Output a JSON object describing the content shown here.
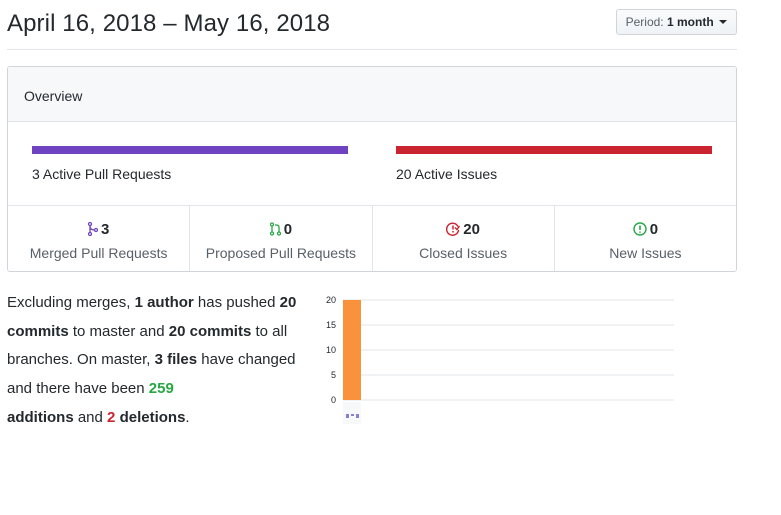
{
  "header": {
    "date_range": "April 16, 2018 – May 16, 2018",
    "period_prefix": "Period:",
    "period_value": "1 month"
  },
  "overview": {
    "title": "Overview",
    "pr_bar_color": "#6f42c1",
    "issue_bar_color": "#cb2431",
    "active_prs_label": "3 Active Pull Requests",
    "active_issues_label": "20 Active Issues",
    "stats": [
      {
        "icon": "git-merge-icon",
        "count": "3",
        "label": "Merged Pull Requests",
        "color": "#6f42c1"
      },
      {
        "icon": "git-pull-request-icon",
        "count": "0",
        "label": "Proposed Pull Requests",
        "color": "#28a745"
      },
      {
        "icon": "issue-closed-icon",
        "count": "20",
        "label": "Closed Issues",
        "color": "#cb2431"
      },
      {
        "icon": "issue-opened-icon",
        "count": "0",
        "label": "New Issues",
        "color": "#28a745"
      }
    ]
  },
  "summary": {
    "p1": "Excluding merges, ",
    "authors": "1 author",
    "p2": " has pushed ",
    "commits_master": "20 commits",
    "p3": " to master and ",
    "commits_all": "20 commits",
    "p4": " to all branches. On master, ",
    "files": "3 files",
    "p5": " have changed and there have been ",
    "additions_num": "259",
    "additions_word": "additions",
    "p6": " and ",
    "deletions_num": "2",
    "deletions_word": "deletions",
    "p7": "."
  },
  "chart_data": {
    "type": "bar",
    "categories": [
      ""
    ],
    "values": [
      20
    ],
    "ylim": [
      0,
      20
    ],
    "yticks": [
      "20",
      "15",
      "10",
      "5",
      "0"
    ],
    "bar_color": "#f9913d",
    "grid": true
  }
}
